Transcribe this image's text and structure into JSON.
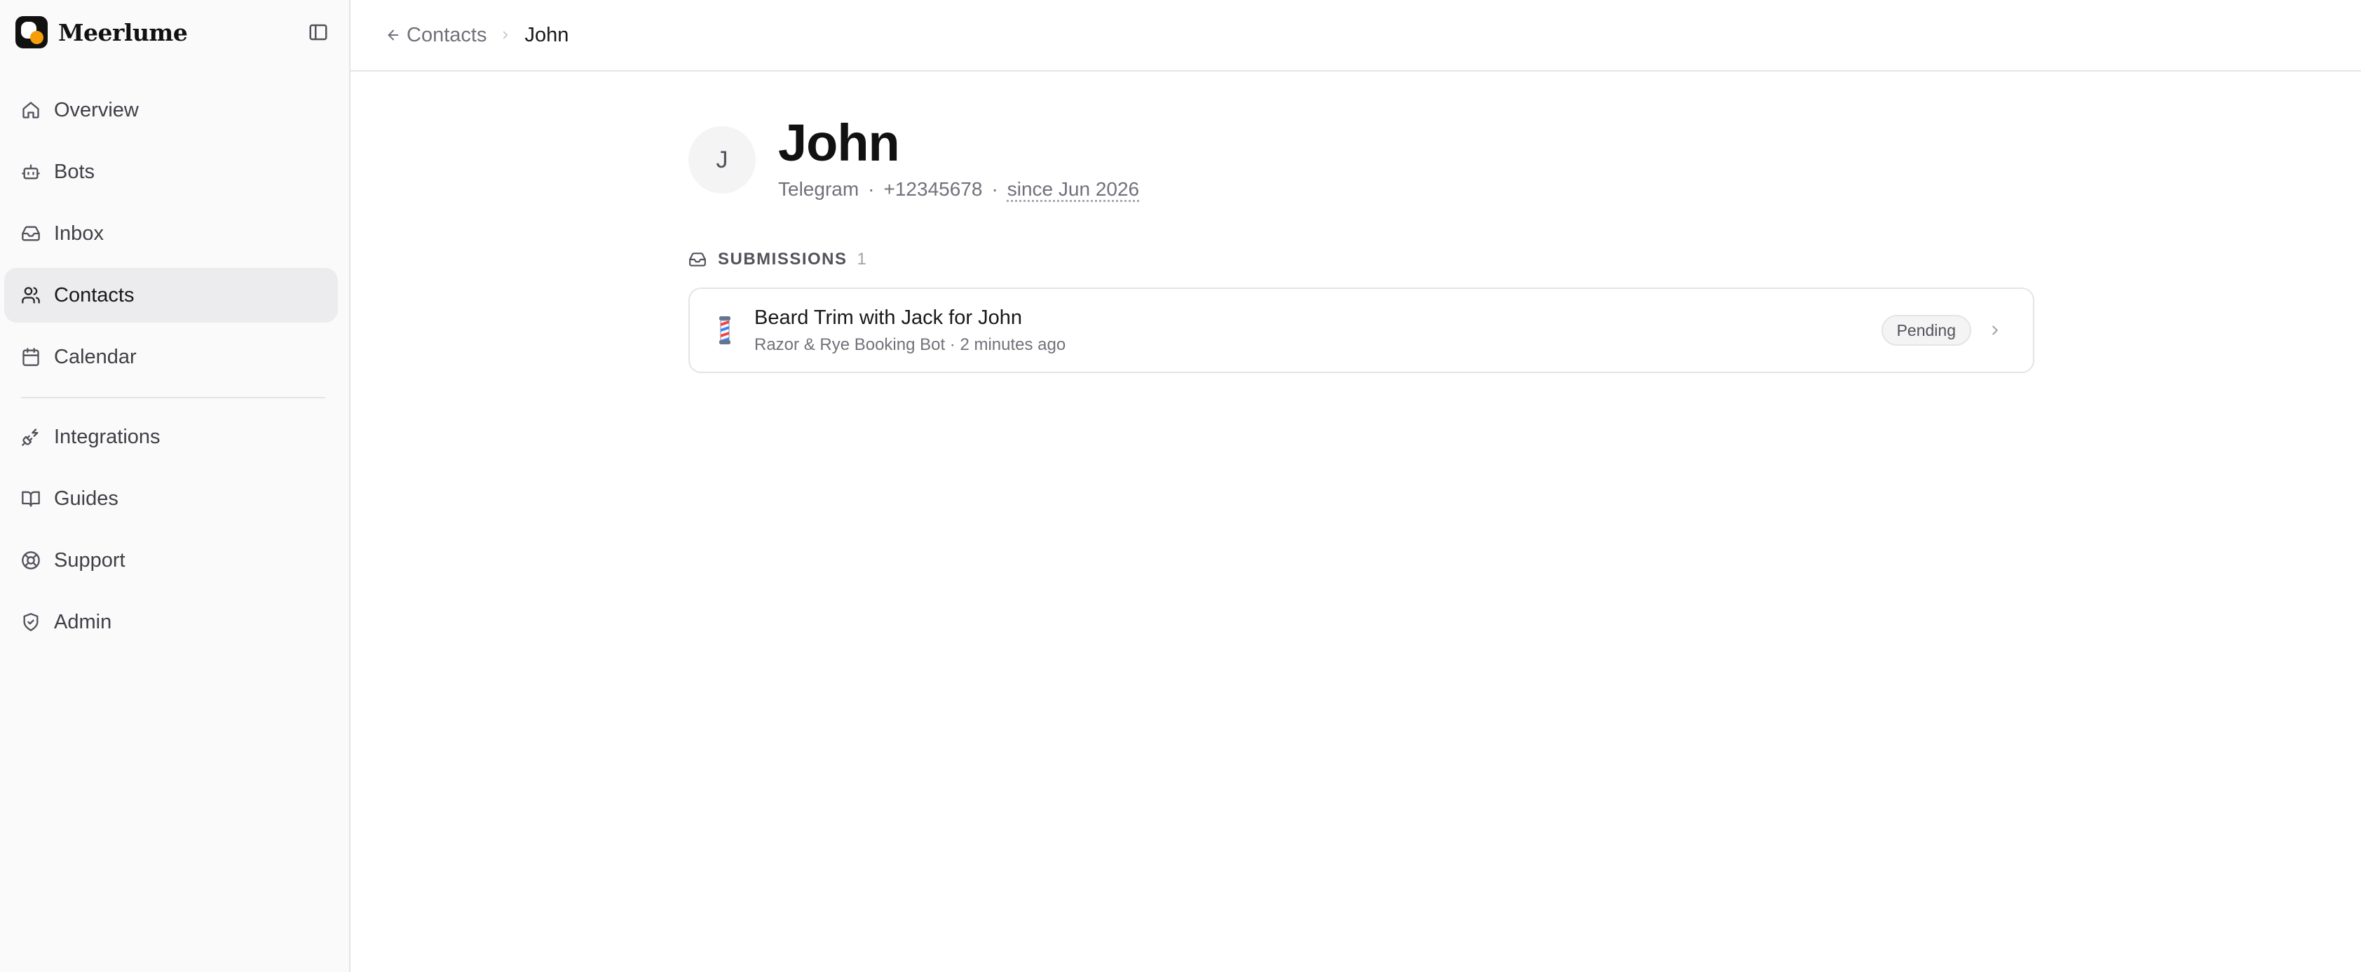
{
  "brand": {
    "name": "Meerlume"
  },
  "sidebar": {
    "items": [
      {
        "label": "Overview",
        "icon": "home-icon"
      },
      {
        "label": "Bots",
        "icon": "bot-icon"
      },
      {
        "label": "Inbox",
        "icon": "inbox-icon"
      },
      {
        "label": "Contacts",
        "icon": "users-icon",
        "active": true
      },
      {
        "label": "Calendar",
        "icon": "calendar-icon"
      },
      {
        "label": "Integrations",
        "icon": "plug-icon"
      },
      {
        "label": "Guides",
        "icon": "book-icon"
      },
      {
        "label": "Support",
        "icon": "life-buoy-icon"
      },
      {
        "label": "Admin",
        "icon": "shield-check-icon"
      }
    ]
  },
  "breadcrumb": {
    "back": "Contacts",
    "current": "John"
  },
  "contact": {
    "initial": "J",
    "name": "John",
    "channel": "Telegram",
    "phone": "+12345678",
    "since": "since Jun 2026"
  },
  "submissions": {
    "label": "SUBMISSIONS",
    "count": "1",
    "items": [
      {
        "title": "Beard Trim with Jack for John",
        "subtitle": "Razor & Rye Booking Bot · 2 minutes ago",
        "status": "Pending",
        "icon": "barber-pole-icon"
      }
    ]
  },
  "colors": {
    "accent": "#f59e0b",
    "active_bg": "#ececee",
    "border": "#e4e4e7"
  }
}
